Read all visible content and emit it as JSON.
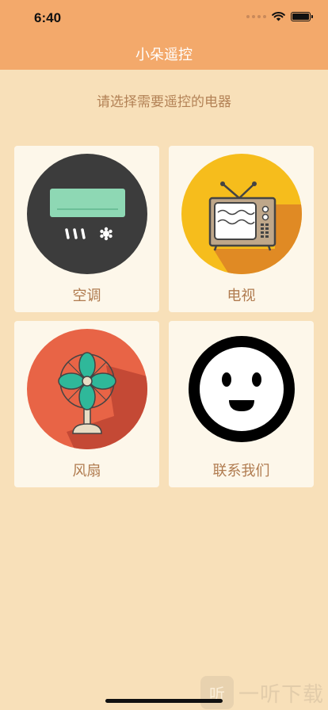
{
  "status_bar": {
    "time": "6:40"
  },
  "header": {
    "title": "小朵遥控"
  },
  "subtitle": "请选择需要遥控的电器",
  "devices": [
    {
      "label": "空调",
      "icon": "air-conditioner-icon",
      "color": "#3c3c3c"
    },
    {
      "label": "电视",
      "icon": "tv-icon",
      "color": "#f6bd1c"
    },
    {
      "label": "风扇",
      "icon": "fan-icon",
      "color": "#e86446"
    },
    {
      "label": "联系我们",
      "icon": "smiley-face-icon",
      "color": "#000000"
    }
  ],
  "watermark": {
    "badge": "听",
    "text": "一听下载"
  }
}
